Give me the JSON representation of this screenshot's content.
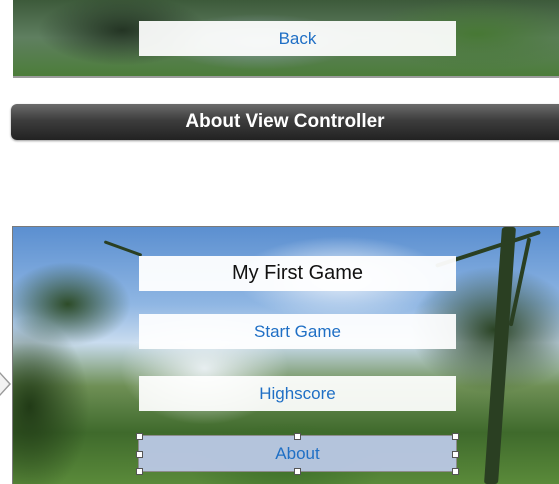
{
  "about_scene": {
    "back_button_label": "Back"
  },
  "scene_dock": {
    "title": "About View Controller"
  },
  "main_scene": {
    "title_label": "My First Game",
    "buttons": [
      {
        "label": "Start Game"
      },
      {
        "label": "Highscore"
      },
      {
        "label": "About",
        "selected": true
      }
    ]
  },
  "colors": {
    "button_text": "#1f6fc5",
    "selected_button_bg": "#bac8e6",
    "dock_bar": "#3d3d3d"
  }
}
